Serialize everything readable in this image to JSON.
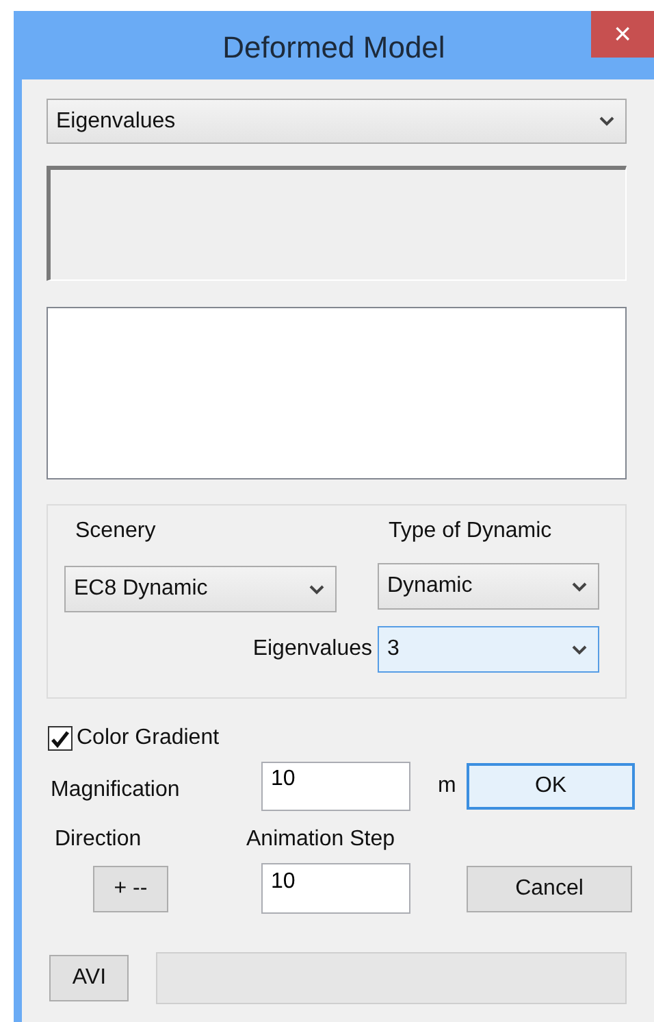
{
  "window": {
    "title": "Deformed Model",
    "close": "×"
  },
  "result_type": {
    "value": "Eigenvalues"
  },
  "scenery": {
    "label": "Scenery",
    "value": "EC8 Dynamic"
  },
  "type_of_dynamic": {
    "label": "Type of Dynamic",
    "value": "Dynamic"
  },
  "eigenvalues": {
    "label": "Eigenvalues",
    "value": "3",
    "focused": true
  },
  "color_gradient": {
    "label": "Color Gradient",
    "checked": true
  },
  "magnification": {
    "label": "Magnification",
    "value": "10",
    "unit": "m"
  },
  "ok_button": {
    "label": "OK",
    "default": true
  },
  "direction": {
    "label": "Direction",
    "button": "+ --"
  },
  "animation_step": {
    "label": "Animation Step",
    "value": "10"
  },
  "cancel_button": {
    "label": "Cancel",
    "default": false
  },
  "avi_button": {
    "label": "AVI"
  }
}
